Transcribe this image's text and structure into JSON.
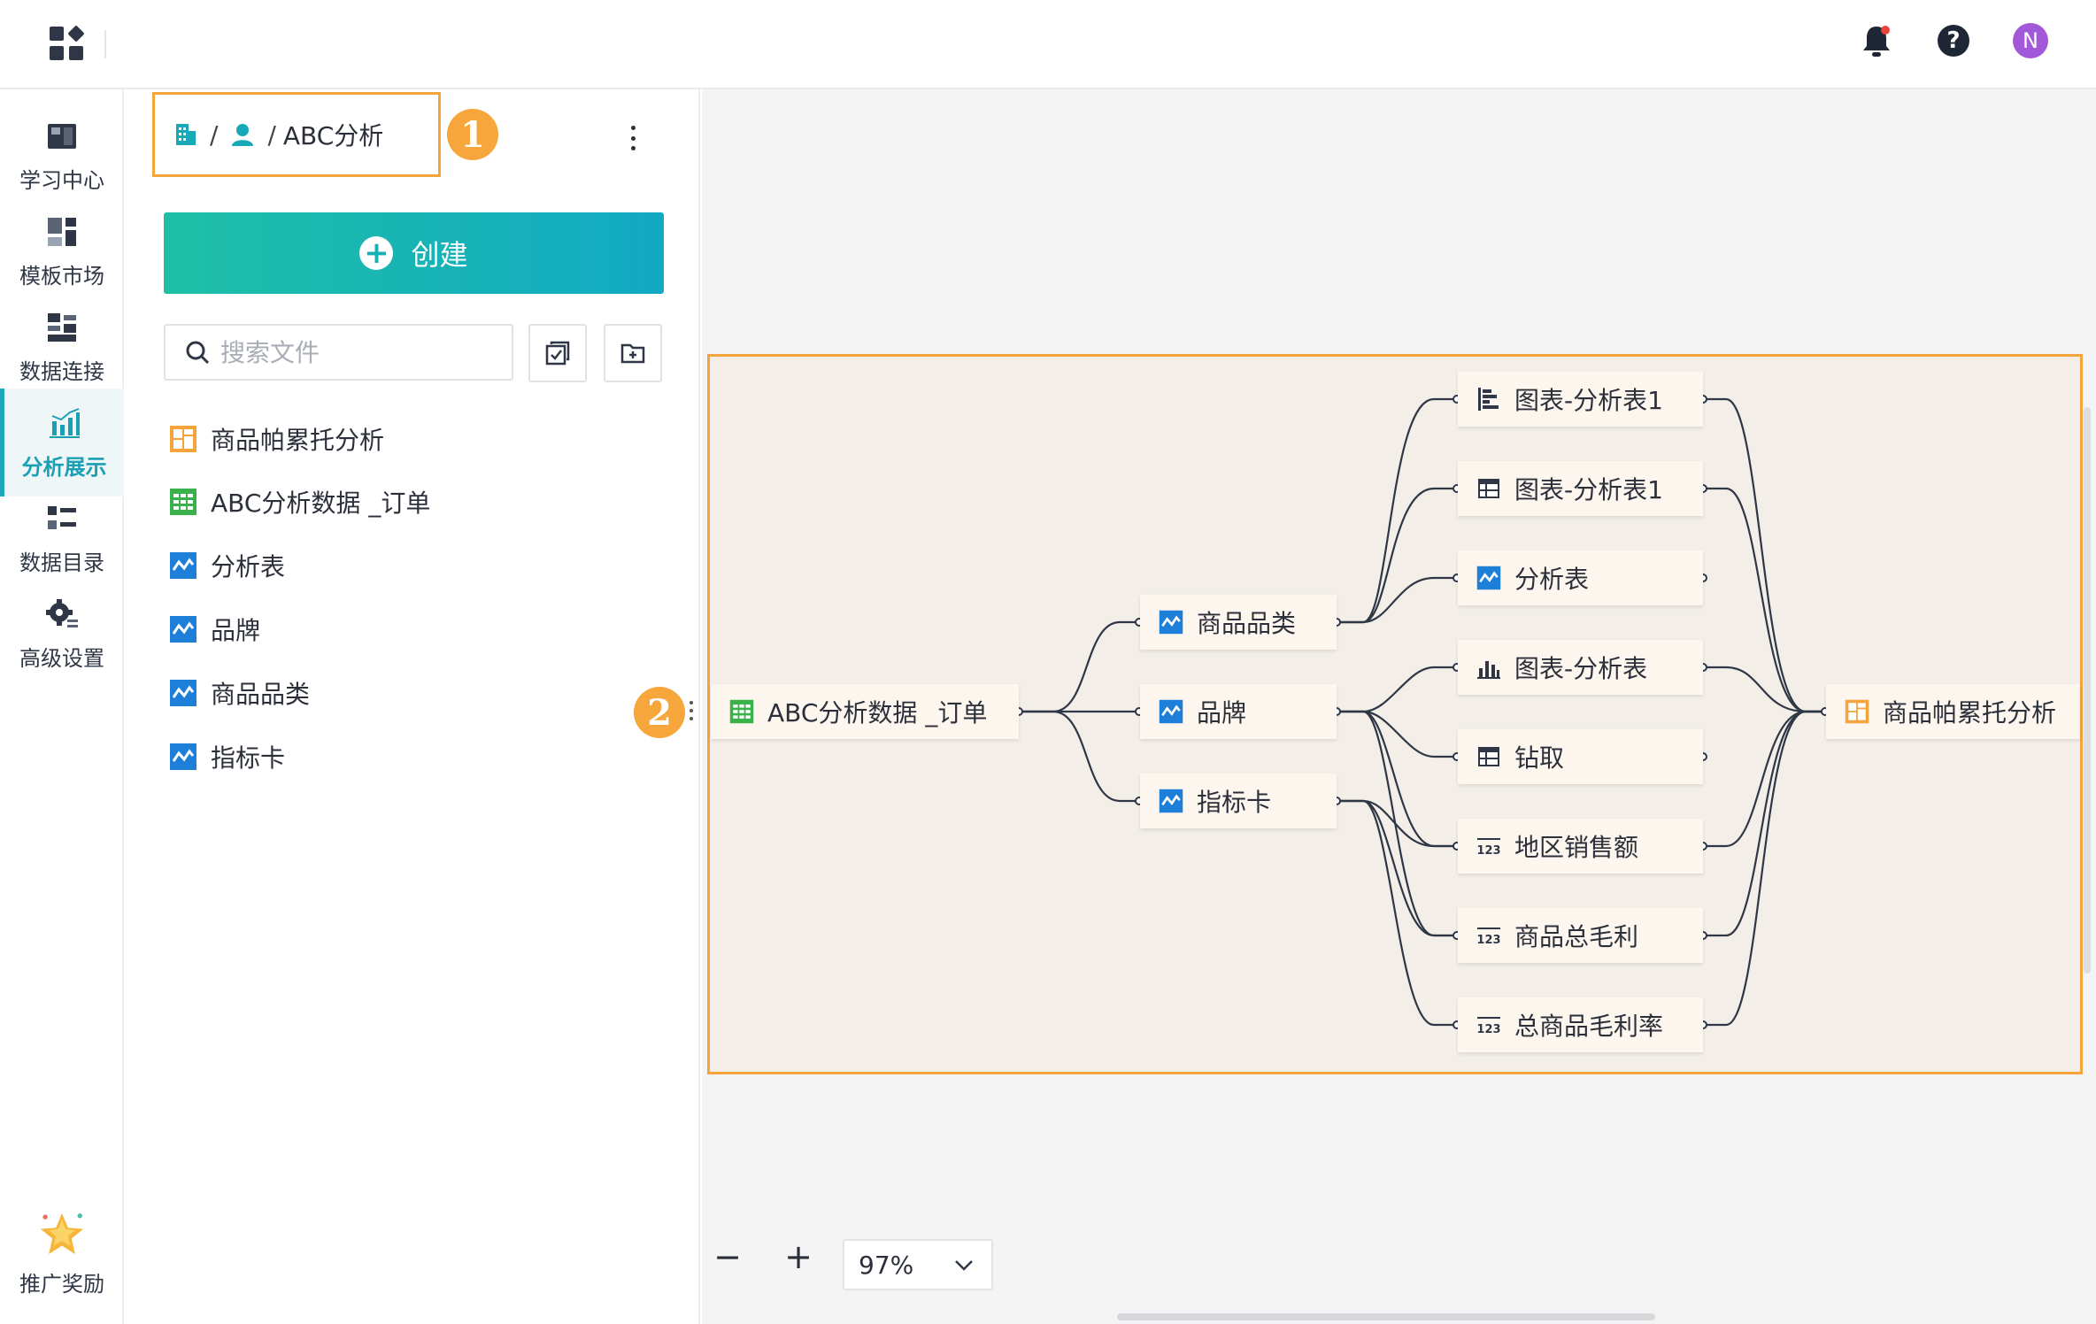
{
  "topbar": {
    "apps_icon": "grid-apps-icon",
    "notification_icon": "bell-icon",
    "help_label": "?",
    "avatar_letter": "N",
    "colors": {
      "avatar": "#a259d9",
      "notification_dot": "#e8453c"
    }
  },
  "leftnav": {
    "items": [
      {
        "label": "学习中心",
        "icon": "book-icon"
      },
      {
        "label": "模板市场",
        "icon": "template-icon"
      },
      {
        "label": "数据连接",
        "icon": "data-connection-icon"
      },
      {
        "label": "分析展示",
        "icon": "chart-bars-icon",
        "active": true
      },
      {
        "label": "数据目录",
        "icon": "catalog-list-icon"
      },
      {
        "label": "高级设置",
        "icon": "gear-icon"
      }
    ],
    "promo": {
      "label": "推广奖励",
      "icon": "star-icon"
    },
    "colors": {
      "active": "#1aa0b4"
    }
  },
  "filepanel": {
    "breadcrumb": {
      "sep": "/",
      "current": "ABC分析"
    },
    "callout_1": "1",
    "create_label": "创建",
    "search": {
      "placeholder": "搜索文件",
      "value": ""
    },
    "files": [
      {
        "label": "商品帕累托分析",
        "icon": "dashboard-icon"
      },
      {
        "label": "ABC分析数据 _订单",
        "icon": "dataset-table-icon"
      },
      {
        "label": "分析表",
        "icon": "analysis-icon"
      },
      {
        "label": "品牌",
        "icon": "analysis-icon"
      },
      {
        "label": "商品品类",
        "icon": "analysis-icon"
      },
      {
        "label": "指标卡",
        "icon": "analysis-icon"
      }
    ]
  },
  "canvas": {
    "callout_2": "2",
    "nodes": {
      "source": "ABC分析数据 _订单",
      "mid_category": "商品品类",
      "mid_brand": "品牌",
      "mid_kpi": "指标卡",
      "c1": "图表-分析表1",
      "c2": "图表-分析表1",
      "c3": "分析表",
      "c4": "图表-分析表",
      "c5": "钻取",
      "c6": "地区销售额",
      "c7": "商品总毛利",
      "c8": "总商品毛利率",
      "target": "商品帕累托分析"
    },
    "zoom": {
      "value": "97%",
      "minus": "−",
      "plus": "+"
    },
    "colors": {
      "frame": "#f5a33b",
      "badge": "#f6a63b",
      "create_start": "#1fbfa6",
      "create_end": "#12a9c3"
    }
  }
}
